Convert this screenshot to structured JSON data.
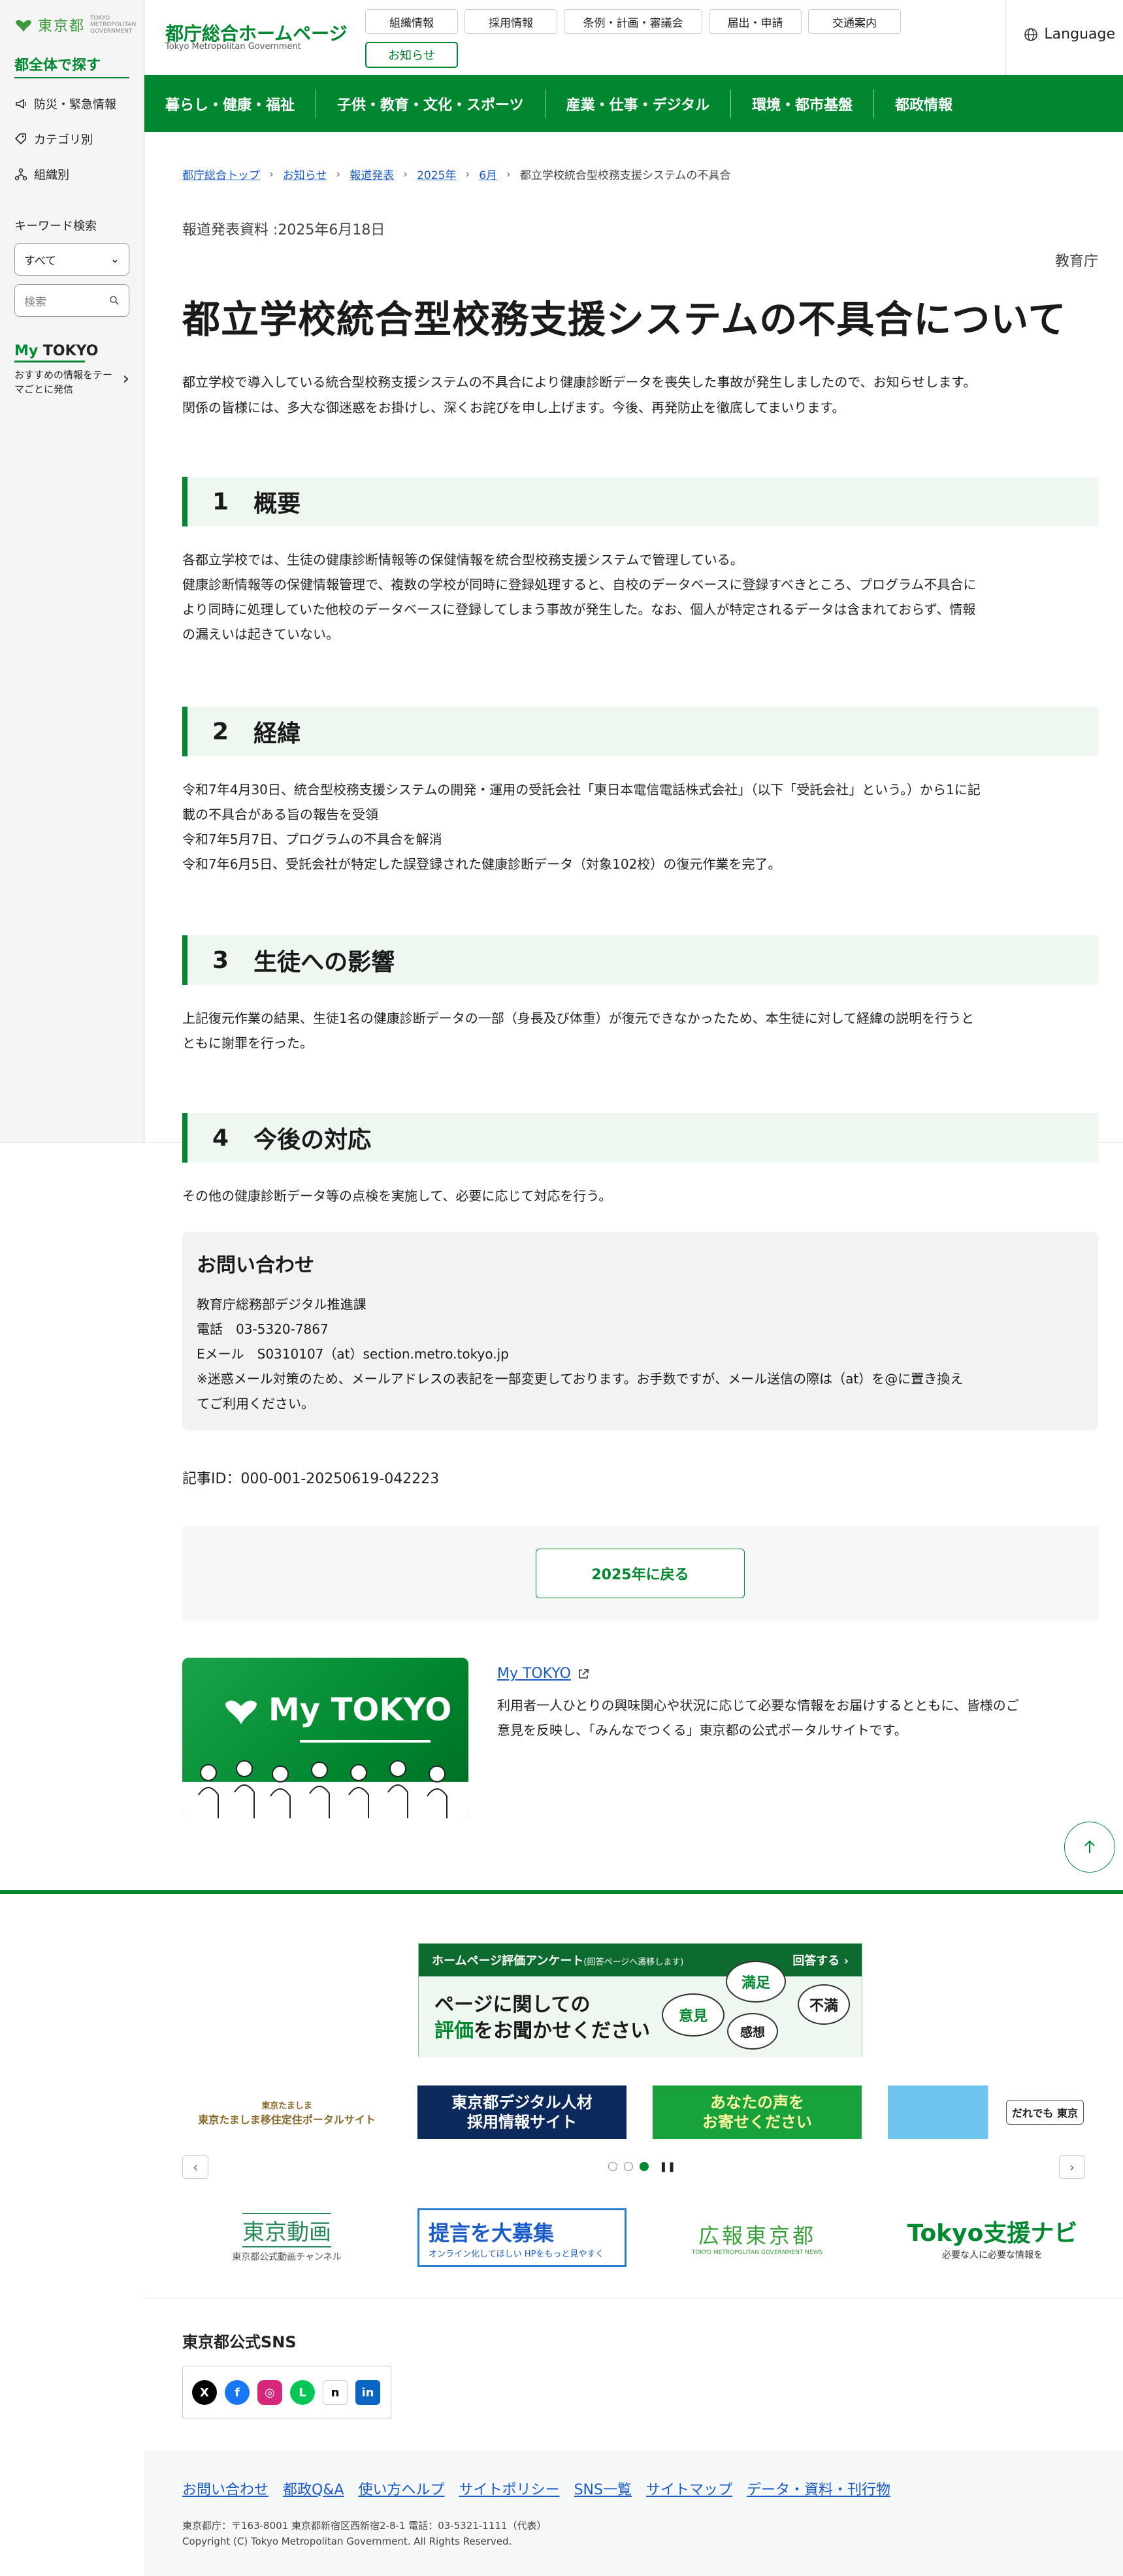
{
  "sidebar": {
    "logo_name": "東京都",
    "logo_en": "TOKYO METROPOLITAN GOVERNMENT",
    "section_title": "都全体で探す",
    "items": [
      {
        "label": "防災・緊急情報"
      },
      {
        "label": "カテゴリ別"
      },
      {
        "label": "組織別"
      }
    ],
    "keyword_title": "キーワード検索",
    "select_value": "すべて",
    "search_placeholder": "検索",
    "mytokyo_logo_a": "My",
    "mytokyo_logo_b": "TOKYO",
    "mytokyo_text": "おすすめの情報をテーマごとに発信"
  },
  "header": {
    "site_title": "都庁総合ホームページ",
    "site_sub": "Tokyo Metropolitan Government",
    "nav": [
      "組織情報",
      "採用情報",
      "条例・計画・審議会",
      "届出・申請",
      "交通案内"
    ],
    "news": "お知らせ",
    "language": "Language"
  },
  "gnav": [
    "暮らし・健康・福祉",
    "子供・教育・文化・スポーツ",
    "産業・仕事・デジタル",
    "環境・都市基盤",
    "都政情報"
  ],
  "breadcrumb": {
    "links": [
      "都庁総合トップ",
      "お知らせ",
      "報道発表",
      "2025年",
      "6月"
    ],
    "current": "都立学校統合型校務支援システムの不具合"
  },
  "article": {
    "press_date": "報道発表資料 :2025年6月18日",
    "bureau": "教育庁",
    "title": "都立学校統合型校務支援システムの不具合について",
    "lead1": "都立学校で導入している統合型校務支援システムの不具合により健康診断データを喪失した事故が発生しましたので、お知らせします。",
    "lead2": "関係の皆様には、多大な御迷惑をお掛けし、深くお詫びを申し上げます。今後、再発防止を徹底してまいります。",
    "sections": [
      {
        "num": "1",
        "heading": "概要",
        "lines": [
          "各都立学校では、生徒の健康診断情報等の保健情報を統合型校務支援システムで管理している。",
          "健康診断情報等の保健情報管理で、複数の学校が同時に登録処理すると、自校のデータベースに登録すべきところ、プログラム不具合に",
          "より同時に処理していた他校のデータベースに登録してしまう事故が発生した。なお、個人が特定されるデータは含まれておらず、情報",
          "の漏えいは起きていない。"
        ]
      },
      {
        "num": "2",
        "heading": "経緯",
        "lines": [
          "令和7年4月30日、統合型校務支援システムの開発・運用の受託会社「東日本電信電話株式会社」（以下「受託会社」という。）から1に記",
          "載の不具合がある旨の報告を受領",
          "令和7年5月7日、プログラムの不具合を解消",
          "令和7年6月5日、受託会社が特定した誤登録された健康診断データ（対象102校）の復元作業を完了。"
        ]
      },
      {
        "num": "3",
        "heading": "生徒への影響",
        "lines": [
          "上記復元作業の結果、生徒1名の健康診断データの一部（身長及び体重）が復元できなかったため、本生徒に対して経緯の説明を行うと",
          "ともに謝罪を行った。"
        ]
      },
      {
        "num": "4",
        "heading": "今後の対応",
        "lines": [
          "その他の健康診断データ等の点検を実施して、必要に応じて対応を行う。"
        ]
      }
    ],
    "contact": {
      "title": "お問い合わせ",
      "lines": [
        "教育庁総務部デジタル推進課",
        "電話　03-5320-7867",
        "Eメール　S0310107（at）section.metro.tokyo.jp",
        "※迷惑メール対策のため、メールアドレスの表記を一部変更しております。お手数ですが、メール送信の際は（at）を@に置き換え",
        "てご利用ください。"
      ]
    },
    "article_id": "記事ID：000-001-20250619-042223",
    "back_button": "2025年に戻る"
  },
  "mytokyo": {
    "card_logo": "My TOKYO",
    "link": "My TOKYO",
    "desc1": "利用者一人ひとりの興味関心や状況に応じて必要な情報をお届けするとともに、皆様のご",
    "desc2": "意見を反映し、「みんなでつくる」東京都の公式ポータルサイトです。"
  },
  "survey": {
    "head": "ホームページ評価アンケート",
    "head_small": "(回答ページへ遷移します)",
    "answer": "回答する ›",
    "text_a": "ページに関しての",
    "text_b1": "評価",
    "text_b2": "をお聞かせください",
    "b1": "満足",
    "b2": "不満",
    "b3": "意見",
    "b4": "感想"
  },
  "banners": {
    "b1_top": "東京たましま",
    "b1": "東京たましま移住定住ポータルサイト",
    "b2a": "東京都デジタル人材",
    "b2b": "採用情報サイト",
    "b3a": "あなたの声を",
    "b3b": "お寄せください",
    "b4": "だれでも 東京"
  },
  "logos": {
    "l1": "東京動画",
    "l1_sub": "東京都公式動画チャンネル",
    "l2": "提言を大募集",
    "l2_sub": "オンライン化してほしい HPをもっと見やすく",
    "l3": "広報東京都",
    "l3_sub": "TOKYO METROPOLITAN GOVERNMENT NEWS",
    "l4": "Tokyo支援ナビ",
    "l4_sub": "必要な人に必要な情報を"
  },
  "sns": {
    "title": "東京都公式SNS",
    "icons": [
      "X",
      "f",
      "◎",
      "L",
      "n",
      "in"
    ]
  },
  "footer": {
    "links": [
      "お問い合わせ",
      "都政Q&A",
      "使い方ヘルプ",
      "サイトポリシー",
      "SNS一覧",
      "サイトマップ",
      "データ・資料・刊行物"
    ],
    "address": "東京都庁：〒163-8001 東京都新宿区西新宿2-8-1 電話：03-5321-1111（代表）",
    "copyright": "Copyright (C) Tokyo Metropolitan Government. All Rights Reserved."
  },
  "colors": {
    "brand_green": "#00872f",
    "link_blue": "#1a5bc9"
  }
}
